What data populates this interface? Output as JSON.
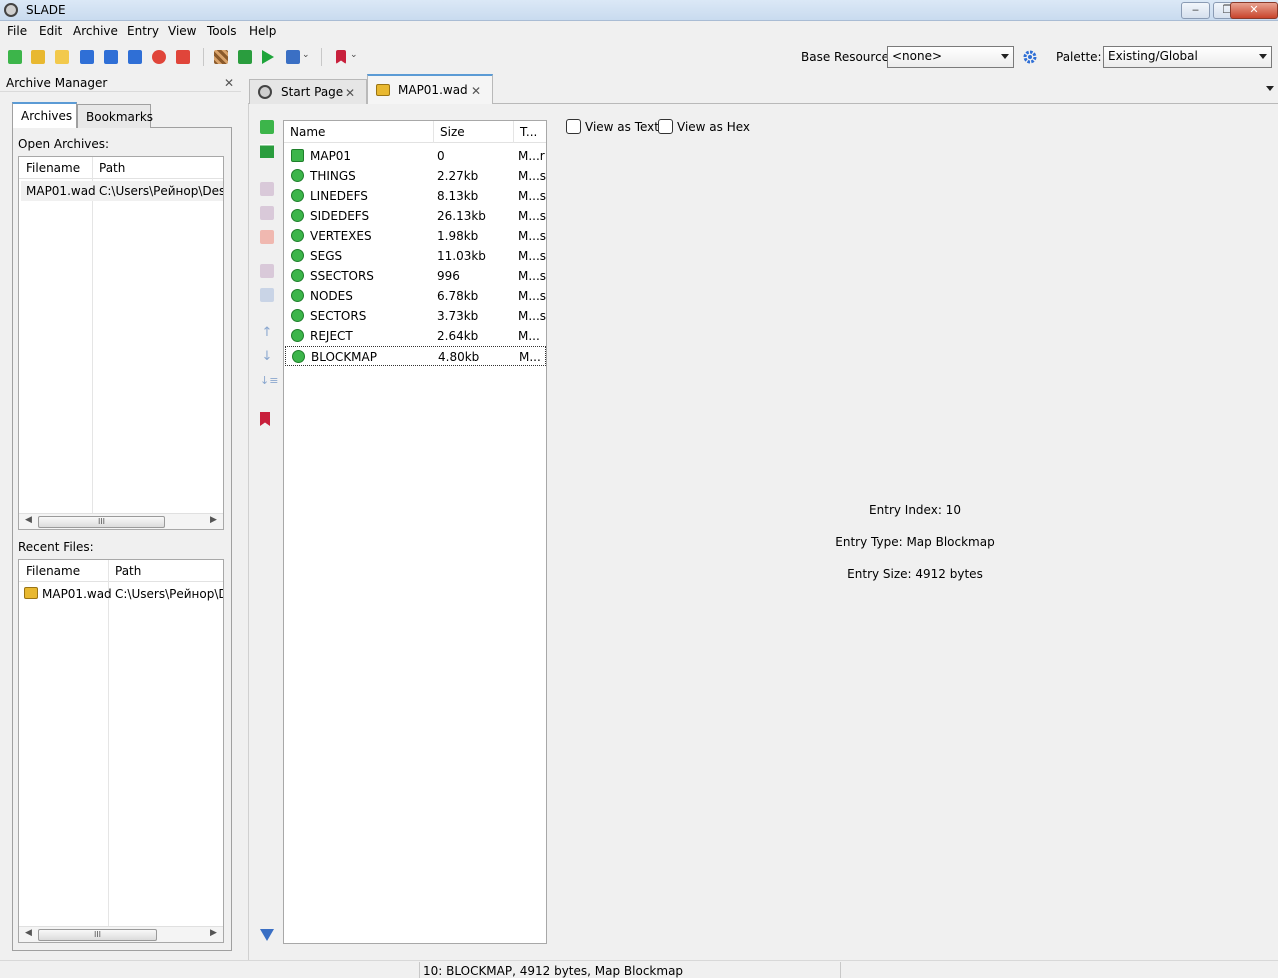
{
  "window": {
    "title": "SLADE",
    "min": "‒",
    "max": "❐",
    "close": "✕"
  },
  "menu": [
    "File",
    "Edit",
    "Archive",
    "Entry",
    "View",
    "Tools",
    "Help"
  ],
  "toolbar": {
    "base_resource_label": "Base Resource:",
    "base_resource_value": "<none>",
    "palette_label": "Palette:",
    "palette_value": "Existing/Global"
  },
  "archive_manager": {
    "title": "Archive Manager",
    "close": "✕",
    "tabs": [
      "Archives",
      "Bookmarks"
    ],
    "open_archives_label": "Open Archives:",
    "open_columns": [
      "Filename",
      "Path"
    ],
    "open_rows": [
      {
        "filename": "MAP01.wad",
        "path": "C:\\Users\\Рейнор\\Deskt"
      }
    ],
    "recent_label": "Recent Files:",
    "recent_columns": [
      "Filename",
      "Path"
    ],
    "recent_rows": [
      {
        "filename": "MAP01.wad",
        "path": "C:\\Users\\Рейнор\\De"
      }
    ],
    "scroll_thumb": "III"
  },
  "doc_tabs": [
    {
      "label": "Start Page",
      "close": "✕"
    },
    {
      "label": "MAP01.wad",
      "close": "✕"
    }
  ],
  "entry_list": {
    "columns": [
      "Name",
      "Size",
      "T..."
    ],
    "rows": [
      {
        "name": "MAP01",
        "size": "0",
        "type": "M...r",
        "icon": "map-marker-icon"
      },
      {
        "name": "THINGS",
        "size": "2.27kb",
        "type": "M...s",
        "icon": "map-lump-icon"
      },
      {
        "name": "LINEDEFS",
        "size": "8.13kb",
        "type": "M...s",
        "icon": "map-lump-icon"
      },
      {
        "name": "SIDEDEFS",
        "size": "26.13kb",
        "type": "M...s",
        "icon": "map-lump-icon"
      },
      {
        "name": "VERTEXES",
        "size": "1.98kb",
        "type": "M...s",
        "icon": "map-lump-icon"
      },
      {
        "name": "SEGS",
        "size": "11.03kb",
        "type": "M...s",
        "icon": "map-lump-icon"
      },
      {
        "name": "SSECTORS",
        "size": "996",
        "type": "M...s",
        "icon": "map-lump-icon"
      },
      {
        "name": "NODES",
        "size": "6.78kb",
        "type": "M...s",
        "icon": "map-lump-icon"
      },
      {
        "name": "SECTORS",
        "size": "3.73kb",
        "type": "M...s",
        "icon": "map-lump-icon"
      },
      {
        "name": "REJECT",
        "size": "2.64kb",
        "type": "M...",
        "icon": "map-lump-icon"
      },
      {
        "name": "BLOCKMAP",
        "size": "4.80kb",
        "type": "M...",
        "icon": "map-lump-icon"
      }
    ],
    "selected_index": 10
  },
  "view_buttons": {
    "text": "View as Text",
    "hex": "View as Hex"
  },
  "entry_info": {
    "index": "Entry Index: 10",
    "type": "Entry Type: Map Blockmap",
    "size": "Entry Size: 4912 bytes"
  },
  "status": {
    "text": "10: BLOCKMAP, 4912 bytes, Map Blockmap"
  },
  "colors": {
    "accent": "#5b9bd5",
    "entry_icon": "#3cb54a",
    "bookmark": "#c8203c"
  }
}
